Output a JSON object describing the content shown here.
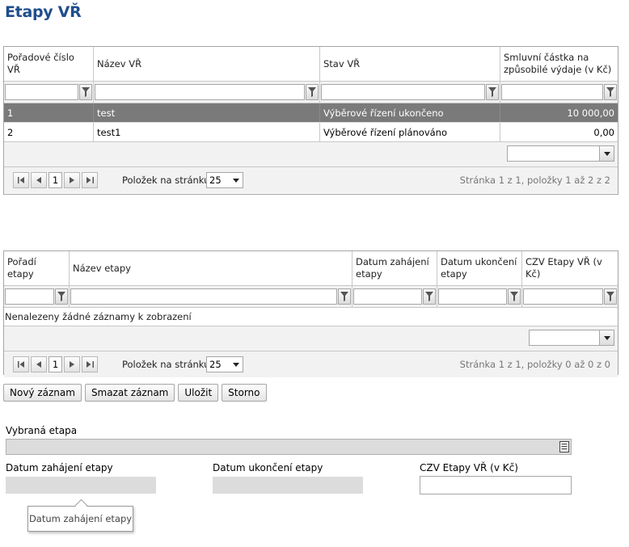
{
  "page": {
    "title": "Etapy VŘ"
  },
  "grid1": {
    "columns": [
      "Pořadové číslo VŘ",
      "Název VŘ",
      "Stav VŘ",
      "Smluvní částka na způsobilé výdaje (v Kč)"
    ],
    "rows": [
      [
        "1",
        "test",
        "Výběrové řízení ukončeno",
        "10 000,00"
      ],
      [
        "2",
        "test1",
        "Výběrové řízení plánováno",
        "0,00"
      ]
    ],
    "selected_row": 0,
    "pager": {
      "page": "1",
      "per_page_label": "Položek na stránku",
      "per_page": "25",
      "info": "Stránka 1 z 1, položky 1 až 2 z 2"
    }
  },
  "grid2": {
    "columns": [
      "Pořadí etapy",
      "Název etapy",
      "Datum zahájení etapy",
      "Datum ukončení etapy",
      "CZV Etapy VŘ (v Kč)"
    ],
    "empty_text": "Nenalezeny žádné záznamy k zobrazení",
    "pager": {
      "page": "1",
      "per_page_label": "Položek na stránku",
      "per_page": "25",
      "info": "Stránka 1 z 1, položky 0 až 0 z 0"
    }
  },
  "buttons": {
    "new": "Nový záznam",
    "delete": "Smazat záznam",
    "save": "Uložit",
    "cancel": "Storno"
  },
  "form": {
    "selected_stage_label": "Vybraná etapa",
    "start_date_label": "Datum zahájení etapy",
    "end_date_label": "Datum ukončení etapy",
    "czv_label": "CZV Etapy VŘ (v Kč)"
  },
  "tooltip": {
    "text": "Datum zahájení etapy"
  },
  "colors": {
    "title": "#1f4e8c",
    "selected_row": "#7a7a7a",
    "disabled_field": "#dcdcdc"
  }
}
